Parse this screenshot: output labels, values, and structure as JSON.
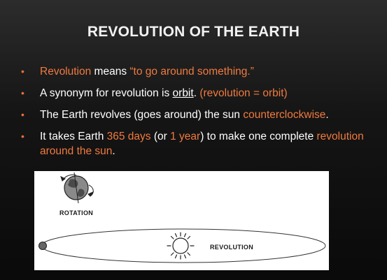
{
  "slide": {
    "title": "REVOLUTION OF THE EARTH",
    "bullet_glyph": "•",
    "accent_color": "#f07a3f",
    "bullets": [
      {
        "parts": [
          "Revolution",
          " means ",
          "“to go around something.”"
        ]
      },
      {
        "parts": [
          "A synonym for revolution is ",
          "orbit",
          ". ",
          "(revolution = orbit)"
        ]
      },
      {
        "parts": [
          "The Earth revolves (goes around) the sun ",
          "counterclockwise",
          "."
        ]
      },
      {
        "parts": [
          "It takes Earth ",
          "365 days",
          " (or ",
          "1 year",
          ") to make one complete ",
          "revolution around the sun",
          "."
        ]
      }
    ]
  },
  "diagram": {
    "rotation_label": "ROTATION",
    "revolution_label": "REVOLUTION",
    "icons": [
      "earth-globe-icon",
      "rotation-arrow-icon",
      "sun-icon",
      "earth-dot-icon"
    ]
  }
}
